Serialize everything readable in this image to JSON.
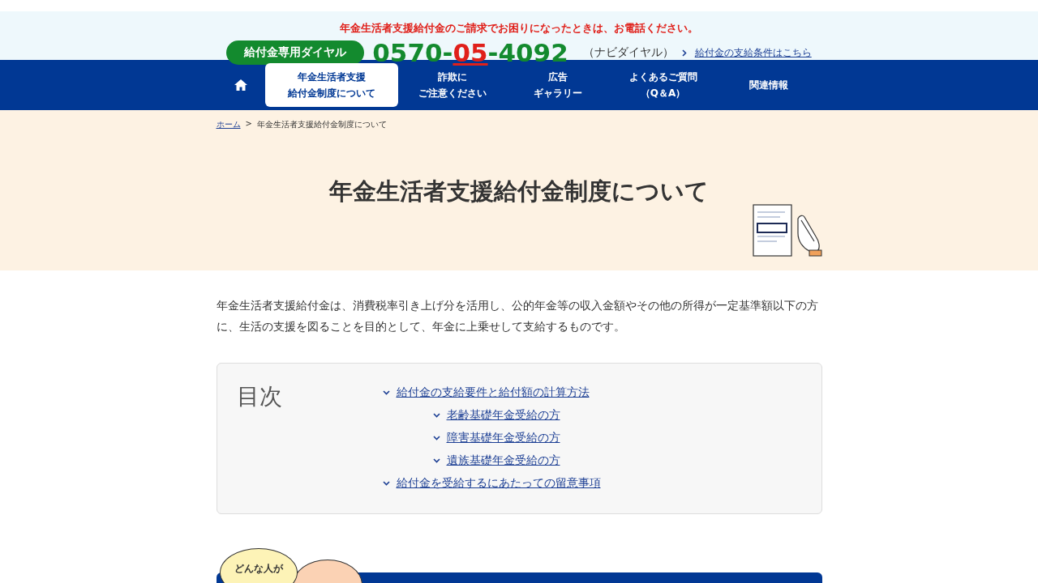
{
  "contact_banner": {
    "notice": "年金生活者支援給付金のご請求でお困りになったときは、お電話ください。",
    "dial_label": "給付金専用ダイヤル",
    "phone": [
      {
        "text": "0570-",
        "highlight": false
      },
      {
        "text": "05",
        "highlight": true
      },
      {
        "text": "-4092",
        "highlight": false
      }
    ],
    "phone_note": "（ナビダイヤル）",
    "link": "給付金の支給条件はこちら"
  },
  "nav": [
    {
      "kind": "icon",
      "selected": false
    },
    {
      "kind": "text",
      "lines": [
        "年金生活者支援",
        "給付金制度について"
      ],
      "selected": true
    },
    {
      "kind": "text",
      "lines": [
        "詐欺に",
        "ご注意ください"
      ],
      "selected": false
    },
    {
      "kind": "text",
      "lines": [
        "広告",
        "ギャラリー"
      ],
      "selected": false
    },
    {
      "kind": "text",
      "lines": [
        "よくあるご質問",
        "（Q＆A）"
      ],
      "selected": false
    },
    {
      "kind": "text",
      "lines": [
        "関連情報"
      ],
      "selected": false
    }
  ],
  "breadcrumb": {
    "home": "ホーム",
    "separator": ">",
    "current": "年金生活者支援給付金制度について"
  },
  "page_title": "年金生活者支援給付金制度について",
  "intro": "年金生活者支援給付金は、消費税率引き上げ分を活用し、公的年金等の収入金額やその他の所得が一定基準額以下の方に、生活の支援を図ることを目的として、年金に上乗せして支給するものです。",
  "toc": {
    "heading": "目次",
    "items": [
      {
        "label": "給付金の支給要件と給付額の計算方法",
        "children": [
          {
            "label": "老齢基礎年金受給の方"
          },
          {
            "label": "障害基礎年金受給の方"
          },
          {
            "label": "遺族基礎年金受給の方"
          }
        ]
      },
      {
        "label": "給付金を受給するにあたっての留意事項"
      }
    ]
  },
  "bubble": "どんな人が"
}
